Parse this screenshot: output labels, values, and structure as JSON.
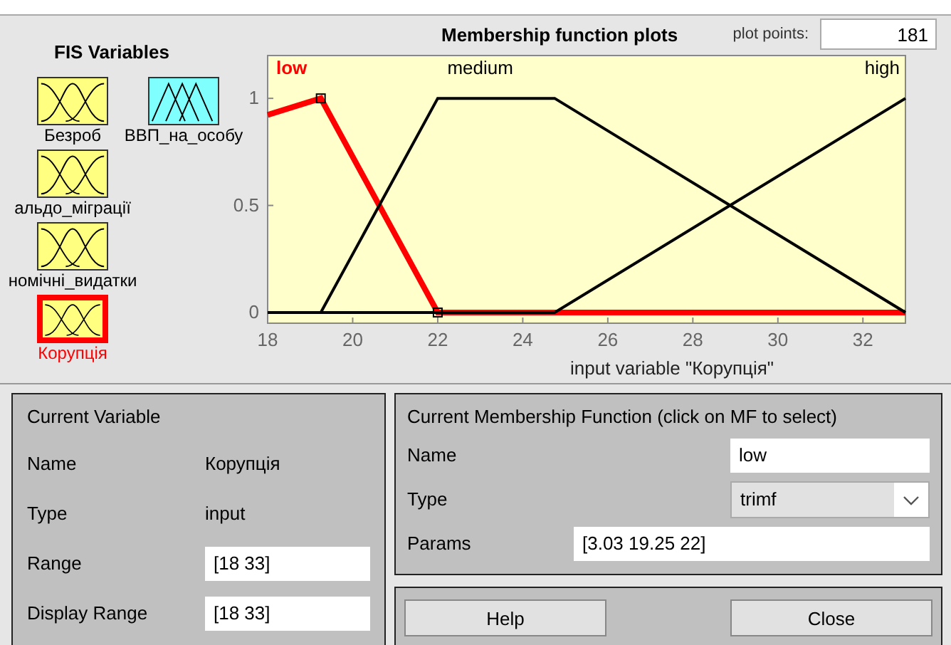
{
  "fis_variables": {
    "title": "FIS Variables",
    "items": [
      {
        "label": "Безроб",
        "kind": "input",
        "selected": false
      },
      {
        "label": "ВВП_на_особу",
        "kind": "output",
        "selected": false
      },
      {
        "label": "альдо_міграції",
        "kind": "input",
        "selected": false
      },
      {
        "label": "номічні_видатки",
        "kind": "input",
        "selected": false
      },
      {
        "label": "Корупція",
        "kind": "input",
        "selected": true
      }
    ]
  },
  "plot": {
    "plot_points_label": "plot points:",
    "plot_points": "181",
    "functions": [
      {
        "selected": true
      },
      {
        "selected": false
      },
      {
        "selected": false
      }
    ],
    "chart_data": {
      "type": "line",
      "title": "Membership function plots",
      "xlabel": "input variable \"Корупція\"",
      "x": [
        18,
        19.25,
        22,
        24.75,
        33
      ],
      "xlim": [
        18,
        33
      ],
      "ylim": [
        -0.05,
        1.2
      ],
      "xticks": [
        18,
        20,
        22,
        24,
        26,
        28,
        30,
        32
      ],
      "yticks": [
        0,
        0.5,
        1
      ],
      "series": [
        {
          "name": "low",
          "color": "#ff0000",
          "values": [
            0.923,
            1,
            0,
            0,
            0
          ]
        },
        {
          "name": "medium",
          "color": "#000000",
          "values": [
            0,
            0,
            1,
            1,
            0
          ]
        },
        {
          "name": "high",
          "color": "#000000",
          "values": [
            0,
            0,
            0,
            0,
            1
          ]
        }
      ]
    }
  },
  "current_variable": {
    "title": "Current Variable",
    "rows": [
      {
        "label": "Name",
        "value": "Корупція",
        "kind": "text"
      },
      {
        "label": "Type",
        "value": "input",
        "kind": "text"
      },
      {
        "label": "Range",
        "value": "[18 33]",
        "kind": "field"
      },
      {
        "label": "Display Range",
        "value": "[18 33]",
        "kind": "field"
      }
    ]
  },
  "current_mf": {
    "title": "Current Membership Function (click on MF to select)",
    "name_label": "Name",
    "name": "low",
    "type_label": "Type",
    "type": "trimf",
    "params_label": "Params",
    "params": "[3.03 19.25 22]"
  },
  "buttons": [
    "Help",
    "Close"
  ]
}
